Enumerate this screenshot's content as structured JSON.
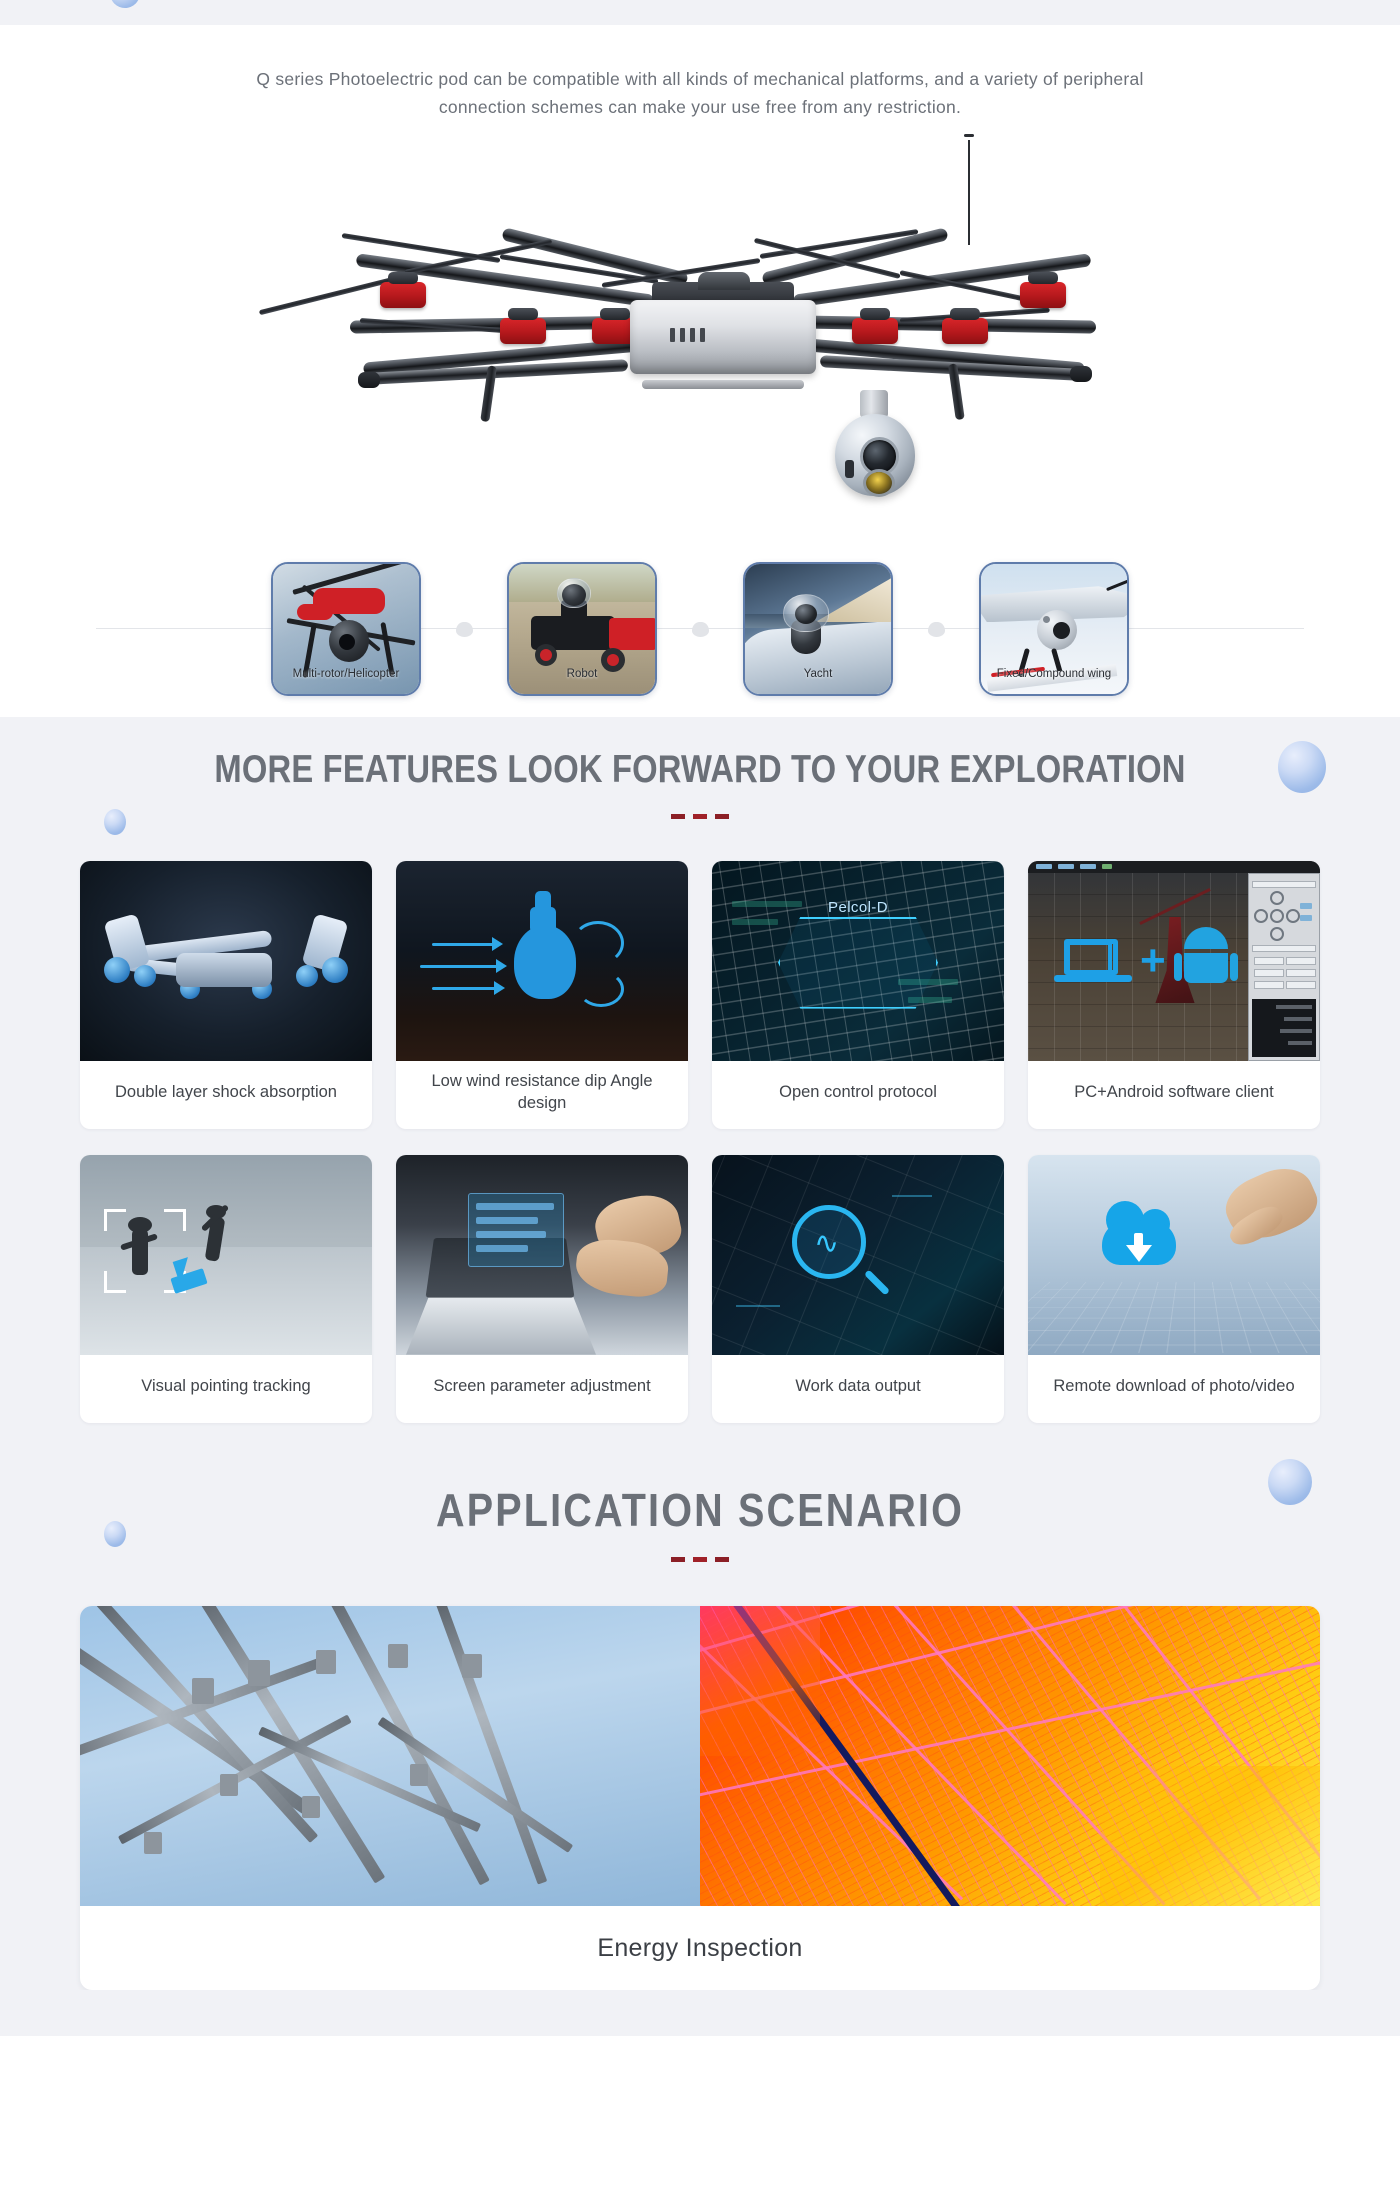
{
  "intro": {
    "paragraph": "Q series Photoelectric pod can be compatible with all kinds of mechanical platforms, and a variety of peripheral connection schemes can make your use free from any restriction."
  },
  "platforms": {
    "items": [
      {
        "label": "Multi-rotor/Helicopter",
        "scene": "multirotor-helicopter"
      },
      {
        "label": "Robot",
        "scene": "ground-robot"
      },
      {
        "label": "Yacht",
        "scene": "yacht"
      },
      {
        "label": "Fixed/Compound wing",
        "scene": "fixed-compound-wing"
      }
    ],
    "separator_icon": "chevron-dot-separator"
  },
  "features": {
    "title": "MORE FEATURES LOOK FORWARD TO YOUR EXPLORATION",
    "divider": "===",
    "cards": [
      {
        "label": "Double layer shock absorption",
        "art": "shock-absorber-illustration"
      },
      {
        "label": "Low wind resistance dip Angle design",
        "art": "airflow-pod-illustration"
      },
      {
        "label": "Open control protocol",
        "art": "protocol-hexagon",
        "overlay_text": "Pelcol-D"
      },
      {
        "label": "PC+Android software client",
        "art": "pc-android-client-screenshot"
      },
      {
        "label": "Visual pointing tracking",
        "art": "tracking-target-photo"
      },
      {
        "label": "Screen parameter adjustment",
        "art": "laptop-parameter-photo"
      },
      {
        "label": "Work data output",
        "art": "data-analysis-illustration"
      },
      {
        "label": "Remote download of photo/video",
        "art": "cloud-download-illustration"
      }
    ]
  },
  "application": {
    "title": "APPLICATION SCENARIO",
    "divider": "===",
    "scenario": {
      "caption": "Energy Inspection",
      "left_image": "power-transmission-tower-photo",
      "right_image": "solar-panel-thermal-image"
    }
  },
  "colors": {
    "section_bg": "#f1f2f6",
    "heading_gray": "#6b7078",
    "accent_red": "#8c1f26",
    "thumb_border": "#5f7cab",
    "sphere_blue": "#9dbbe9",
    "body_text": "#6c7179",
    "card_text": "#41454b"
  }
}
